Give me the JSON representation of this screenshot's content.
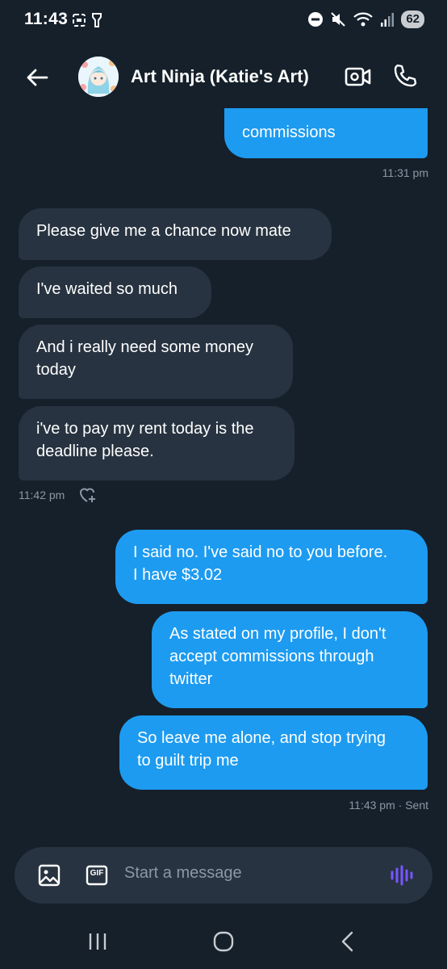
{
  "status_bar": {
    "time": "11:43",
    "battery": "62",
    "icons": [
      "screenshot-icon",
      "flashlight-icon",
      "dnd-icon",
      "mute-icon",
      "wifi-icon",
      "signal-icon"
    ]
  },
  "header": {
    "name": "Art Ninja (Katie's Art)",
    "icons": [
      "back-arrow-icon",
      "video-call-icon",
      "phone-icon"
    ]
  },
  "messages": [
    {
      "side": "sent",
      "text": "I am not interested in commissions"
    },
    {
      "side": "sent",
      "text": "commissions"
    },
    {
      "side": "recv",
      "text": "Please give me a chance now mate"
    },
    {
      "side": "recv",
      "text": "I've waited so much"
    },
    {
      "side": "recv",
      "line1": "And i really need some money",
      "line2": "today"
    },
    {
      "side": "recv",
      "line1": "i've to pay my rent today is the",
      "line2": "deadline please."
    },
    {
      "side": "sent",
      "line1": "I said no. I've said no to you before.",
      "line2": "I have $3.02"
    },
    {
      "side": "sent",
      "line1": "As stated on my profile, I don't",
      "line2": "accept commissions through",
      "line3": "twitter"
    },
    {
      "side": "sent",
      "line1": "So leave me alone, and stop trying",
      "line2": "to guilt trip me"
    }
  ],
  "timestamps": {
    "t1": "11:31 pm",
    "t2": "11:42 pm",
    "t3": "11:43 pm · Sent"
  },
  "composer": {
    "placeholder": "Start a message",
    "gif_label": "GIF"
  },
  "colors": {
    "background": "#15202b",
    "sent_bubble": "#1d9bf0",
    "received_bubble": "#273340",
    "voice_accent": "#7856ff"
  }
}
